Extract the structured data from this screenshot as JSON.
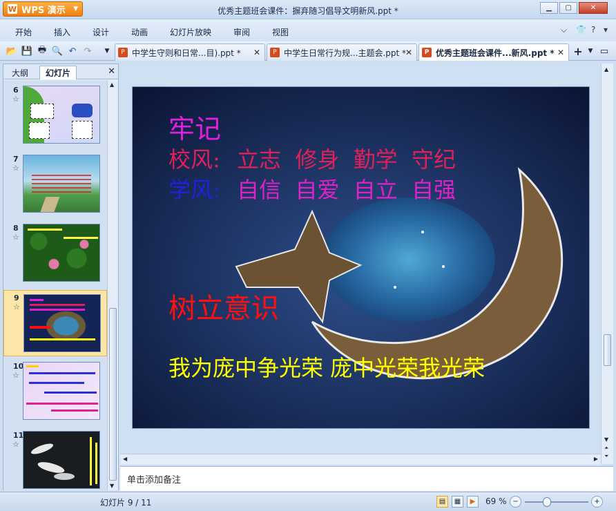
{
  "app": {
    "button_label": "WPS 演示",
    "window_title": "优秀主题班会课件：摒弃随习倡导文明新风.ppt *"
  },
  "menu": [
    "开始",
    "插入",
    "设计",
    "动画",
    "幻灯片放映",
    "审阅",
    "视图"
  ],
  "tabs": [
    {
      "label": "中学生守则和日常...目).ppt *",
      "active": false
    },
    {
      "label": "中学生日常行为规...主题会.ppt *",
      "active": false
    },
    {
      "label": "优秀主题班会课件...新风.ppt *",
      "active": true
    }
  ],
  "left_panel": {
    "tabs": [
      "大纲",
      "幻灯片"
    ],
    "active_tab": "幻灯片",
    "thumbnails": [
      {
        "num": "6",
        "selected": false
      },
      {
        "num": "7",
        "selected": false
      },
      {
        "num": "8",
        "selected": false
      },
      {
        "num": "9",
        "selected": true
      },
      {
        "num": "10",
        "selected": false
      },
      {
        "num": "11",
        "selected": false
      }
    ]
  },
  "slide": {
    "heading1": "牢记",
    "school_motto_label": "校风:",
    "school_motto": "立志  修身  勤学  守纪",
    "study_motto_label": "学风:",
    "study_motto": "自信  自爱  自立  自强",
    "heading2": "树立意识",
    "slogan": "我为庞中争光荣 庞中光荣我光荣",
    "colors": {
      "heading1": "#e020e0",
      "school_motto": "#e0205a",
      "study_label": "#2020e0",
      "study_motto": "#e020c8",
      "heading2": "#ff1010",
      "slogan": "#ffff00"
    }
  },
  "notes_placeholder": "单击添加备注",
  "status": {
    "slide_info": "幻灯片 9 / 11",
    "zoom": "69 %",
    "zoom_fraction": 0.35
  }
}
